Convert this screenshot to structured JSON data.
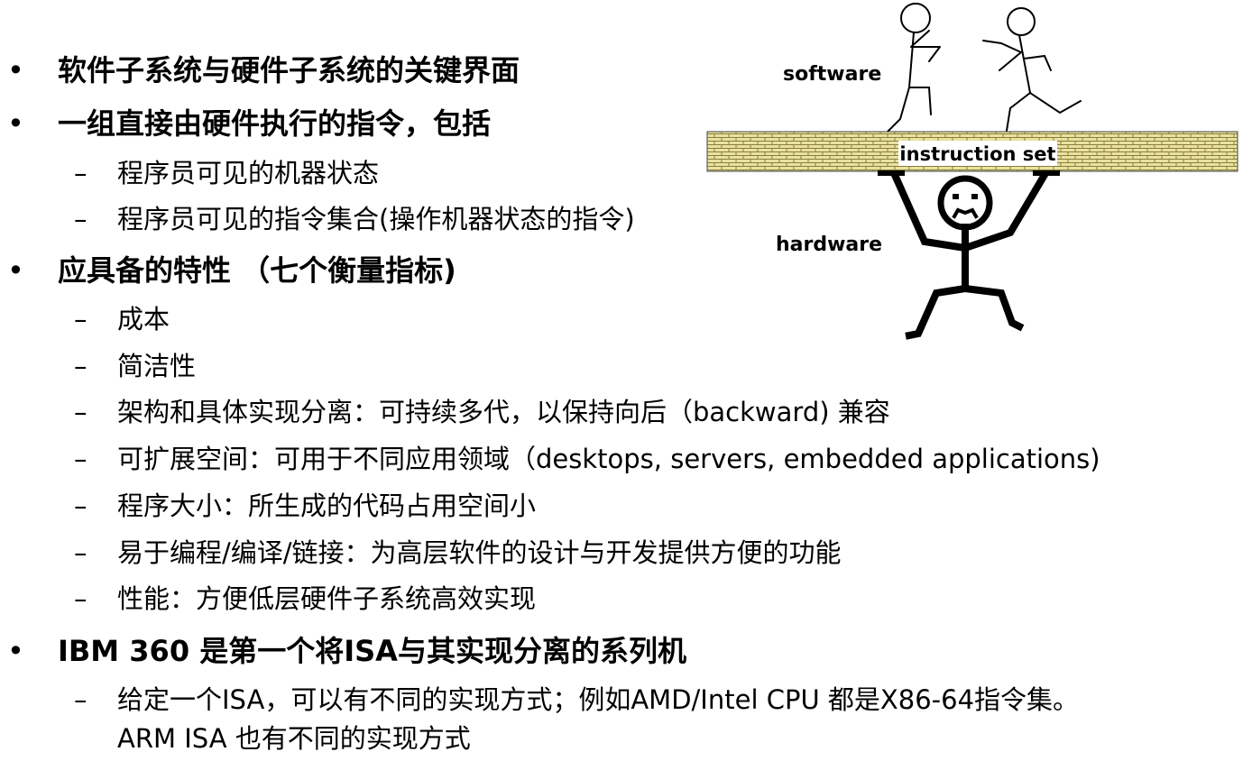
{
  "items": [
    {
      "type": "bullet",
      "text": "软件子系统与硬件子系统的关键界面"
    },
    {
      "type": "bullet",
      "text": "一组直接由硬件执行的指令，包括"
    },
    {
      "type": "sub",
      "text": "程序员可见的机器状态"
    },
    {
      "type": "sub",
      "text": "程序员可见的指令集合(操作机器状态的指令)"
    },
    {
      "type": "bullet",
      "text": "应具备的特性 （七个衡量指标)"
    },
    {
      "type": "sub",
      "text": "成本"
    },
    {
      "type": "sub",
      "text": "简洁性"
    },
    {
      "type": "sub",
      "text": "架构和具体实现分离：可持续多代，以保持向后（backward) 兼容"
    },
    {
      "type": "sub",
      "text": "可扩展空间：可用于不同应用领域（desktops, servers, embedded applications)"
    },
    {
      "type": "sub",
      "text": "程序大小：所生成的代码占用空间小"
    },
    {
      "type": "sub",
      "text": "易于编程/编译/链接：为高层软件的设计与开发提供方便的功能"
    },
    {
      "type": "sub",
      "text": "性能：方便低层硬件子系统高效实现"
    },
    {
      "type": "bullet",
      "text": "IBM 360 是第一个将ISA与其实现分离的系列机"
    },
    {
      "type": "sub",
      "text": "给定一个ISA，可以有不同的实现方式；例如AMD/Intel CPU 都是X86-64指令集。"
    }
  ],
  "continuation": "ARM ISA 也有不同的实现方式",
  "bullet_symbol": "•",
  "dash_symbol": "–",
  "figure": {
    "software_label": "software",
    "hardware_label": "hardware",
    "wall_label": "instruction set",
    "wall_color": "#e9e2a0",
    "brick_line_color": "#8a7f3a"
  }
}
